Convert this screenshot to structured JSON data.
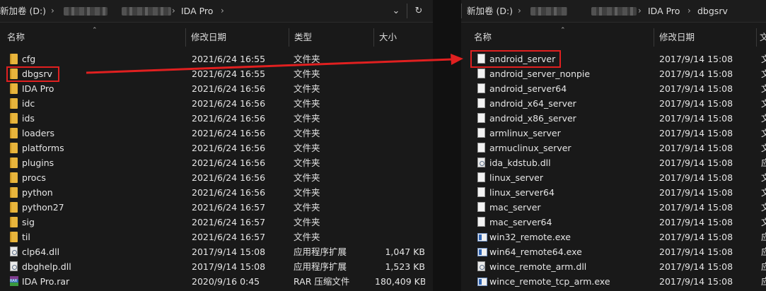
{
  "left": {
    "breadcrumb": {
      "drive": "新加卷 (D:)",
      "current": "IDA Pro"
    },
    "columns": {
      "name": "名称",
      "date": "修改日期",
      "type": "类型",
      "size": "大小"
    },
    "rows": [
      {
        "name": "cfg",
        "date": "2021/6/24 16:55",
        "type": "文件夹",
        "size": "",
        "icon": "folder"
      },
      {
        "name": "dbgsrv",
        "date": "2021/6/24 16:55",
        "type": "文件夹",
        "size": "",
        "icon": "folder"
      },
      {
        "name": "IDA Pro",
        "date": "2021/6/24 16:56",
        "type": "文件夹",
        "size": "",
        "icon": "folder"
      },
      {
        "name": "idc",
        "date": "2021/6/24 16:56",
        "type": "文件夹",
        "size": "",
        "icon": "folder"
      },
      {
        "name": "ids",
        "date": "2021/6/24 16:56",
        "type": "文件夹",
        "size": "",
        "icon": "folder"
      },
      {
        "name": "loaders",
        "date": "2021/6/24 16:56",
        "type": "文件夹",
        "size": "",
        "icon": "folder"
      },
      {
        "name": "platforms",
        "date": "2021/6/24 16:56",
        "type": "文件夹",
        "size": "",
        "icon": "folder"
      },
      {
        "name": "plugins",
        "date": "2021/6/24 16:56",
        "type": "文件夹",
        "size": "",
        "icon": "folder"
      },
      {
        "name": "procs",
        "date": "2021/6/24 16:56",
        "type": "文件夹",
        "size": "",
        "icon": "folder"
      },
      {
        "name": "python",
        "date": "2021/6/24 16:56",
        "type": "文件夹",
        "size": "",
        "icon": "folder"
      },
      {
        "name": "python27",
        "date": "2021/6/24 16:57",
        "type": "文件夹",
        "size": "",
        "icon": "folder"
      },
      {
        "name": "sig",
        "date": "2021/6/24 16:57",
        "type": "文件夹",
        "size": "",
        "icon": "folder"
      },
      {
        "name": "til",
        "date": "2021/6/24 16:57",
        "type": "文件夹",
        "size": "",
        "icon": "folder"
      },
      {
        "name": "clp64.dll",
        "date": "2017/9/14 15:08",
        "type": "应用程序扩展",
        "size": "1,047 KB",
        "icon": "dll"
      },
      {
        "name": "dbghelp.dll",
        "date": "2017/9/14 15:08",
        "type": "应用程序扩展",
        "size": "1,523 KB",
        "icon": "dll"
      },
      {
        "name": "IDA Pro.rar",
        "date": "2020/9/16 0:45",
        "type": "RAR 压缩文件",
        "size": "180,409 KB",
        "icon": "rar"
      }
    ]
  },
  "right": {
    "breadcrumb": {
      "drive": "新加卷 (D:)",
      "middle": "IDA Pro",
      "current": "dbgsrv"
    },
    "columns": {
      "name": "名称",
      "date": "修改日期",
      "type_partial": "文"
    },
    "rows": [
      {
        "name": "android_server",
        "date": "2017/9/14 15:08",
        "type": "文",
        "icon": "file"
      },
      {
        "name": "android_server_nonpie",
        "date": "2017/9/14 15:08",
        "type": "文",
        "icon": "file"
      },
      {
        "name": "android_server64",
        "date": "2017/9/14 15:08",
        "type": "文",
        "icon": "file"
      },
      {
        "name": "android_x64_server",
        "date": "2017/9/14 15:08",
        "type": "文",
        "icon": "file"
      },
      {
        "name": "android_x86_server",
        "date": "2017/9/14 15:08",
        "type": "文",
        "icon": "file"
      },
      {
        "name": "armlinux_server",
        "date": "2017/9/14 15:08",
        "type": "文",
        "icon": "file"
      },
      {
        "name": "armuclinux_server",
        "date": "2017/9/14 15:08",
        "type": "文",
        "icon": "file"
      },
      {
        "name": "ida_kdstub.dll",
        "date": "2017/9/14 15:08",
        "type": "应",
        "icon": "dll"
      },
      {
        "name": "linux_server",
        "date": "2017/9/14 15:08",
        "type": "文",
        "icon": "file"
      },
      {
        "name": "linux_server64",
        "date": "2017/9/14 15:08",
        "type": "文",
        "icon": "file"
      },
      {
        "name": "mac_server",
        "date": "2017/9/14 15:08",
        "type": "文",
        "icon": "file"
      },
      {
        "name": "mac_server64",
        "date": "2017/9/14 15:08",
        "type": "文",
        "icon": "file"
      },
      {
        "name": "win32_remote.exe",
        "date": "2017/9/14 15:08",
        "type": "应",
        "icon": "exe"
      },
      {
        "name": "win64_remote64.exe",
        "date": "2017/9/14 15:08",
        "type": "应",
        "icon": "exe"
      },
      {
        "name": "wince_remote_arm.dll",
        "date": "2017/9/14 15:08",
        "type": "应",
        "icon": "dll"
      },
      {
        "name": "wince_remote_tcp_arm.exe",
        "date": "2017/9/14 15:08",
        "type": "应",
        "icon": "exe"
      }
    ]
  },
  "icons": {
    "dropdown": "chevron-down-icon",
    "refresh": "refresh-icon",
    "separator": "chevron-right-icon"
  },
  "colors": {
    "background": "#191919",
    "folder": "#e8b53c",
    "annotation": "#e02020"
  }
}
